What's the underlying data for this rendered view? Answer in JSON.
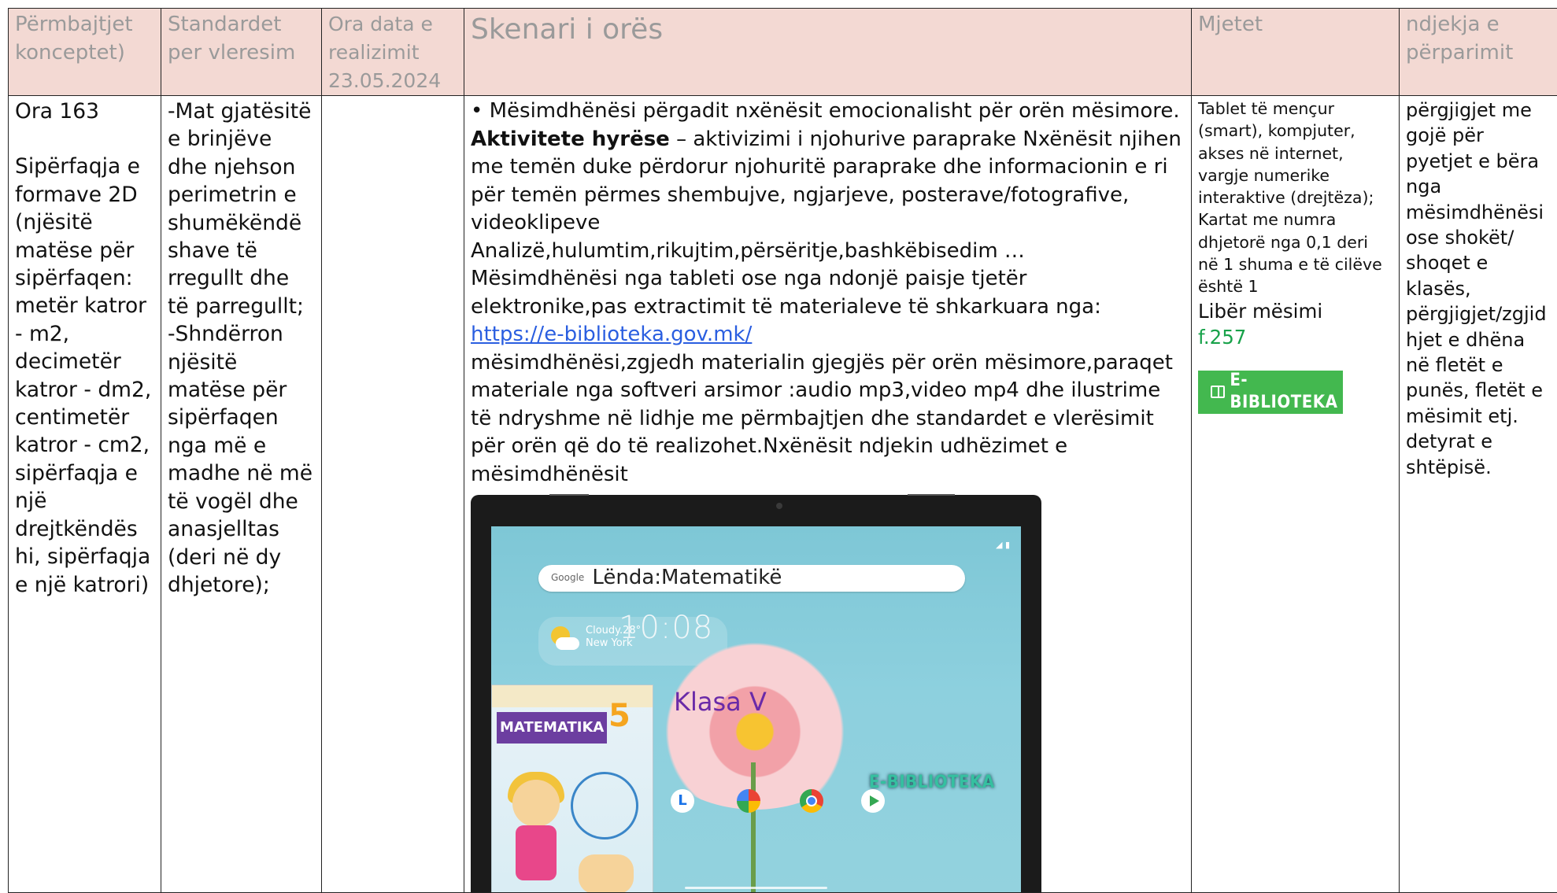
{
  "header": {
    "col1": "Përmbajtjet konceptet)",
    "col2": "Standardet per vleresim",
    "col3": "Ora data e realizimit 23.05.2024",
    "col4": "Skenari i orës",
    "col5": "Mjetet",
    "col6": "ndjekja e përparimit"
  },
  "content": {
    "ora": "Ora 163",
    "tema": "Sipërfaqja e formave 2D (njësitë matëse për sipërfaqen: metër katror - m2, decimetër katror - dm2, centimetër katror - cm2, sipërfaqja e një drejtkëndës hi, sipërfaqja e një katrori)",
    "standardet": "-Mat gjatësitë e brinjëve dhe njehson perimetrin e shumëkëndë shave të rregullt dhe të parregullt; -Shndërron njësitë matëse për sipërfaqen nga më e madhe në më të vogël dhe anasjelltas (deri në dy dhjetore);",
    "ora_data": "",
    "skenari": {
      "p1": "• Mësimdhënësi përgadit nxënësit emocionalisht për orën mësimore.",
      "bold": "Aktivitete hyrëse",
      "p2": " – aktivizimi i njohurive paraprake Nxënësit njihen me temën duke përdorur njohuritë paraprake dhe informacionin e ri për temën përmes shembujve, ngjarjeve, posterave/fotografive, videoklipeve",
      "p3": "Analizë,hulumtim,rikujtim,përsëritje,bashkëbisedim …",
      "p4": "Mësimdhënësi nga tableti ose nga ndonjë paisje tjetër elektronike,pas extractimit të materialeve të shkarkuara nga:",
      "link": "https://e-biblioteka.gov.mk/",
      "p5": "mësimdhënësi,zgjedh materialin gjegjës për orën mësimore,paraqet materiale nga softveri arsimor :audio mp3,video mp4 dhe ilustrime të ndryshme në lidhje me përmbajtjen dhe standardet e vlerësimit për orën që do të realizohet.Nxënësit ndjekin udhëzimet e mësimdhënësit"
    },
    "tablet": {
      "search": "Lënda:Matematikë",
      "google": "Google",
      "weather": "Cloudy.28°",
      "city": "New York",
      "clock": "10:08",
      "book_title": "MATEMATIKA",
      "book_num": "5",
      "klasa": "Klasa V",
      "ebib": "E-BIBLIOTEKA",
      "app_l": "L"
    },
    "mjetet": {
      "small": "Tablet të mençur (smart), kompjuter, akses në internet, vargje numerike interaktive (drejtëza); Kartat me numra dhjetorë nga 0,1 deri në 1 shuma e të cilëve është 1",
      "liber": "Libër mësimi",
      "faqe": "f.257",
      "badge": "E-BIBLIOTEKA"
    },
    "ndjekja": "përgjigjet me gojë për pyetjet e bëra nga mësimdhënësi ose shokët/ shoqet e klasës, përgjigjet/zgjid hjet e dhëna në fletët e punës, fletët e mësimit etj. detyrat e shtëpisë."
  },
  "colors": {
    "header_bg": "#f3d9d3",
    "header_text": "#9a9a9a",
    "link": "#2a5ee0",
    "green": "#18a24a"
  }
}
